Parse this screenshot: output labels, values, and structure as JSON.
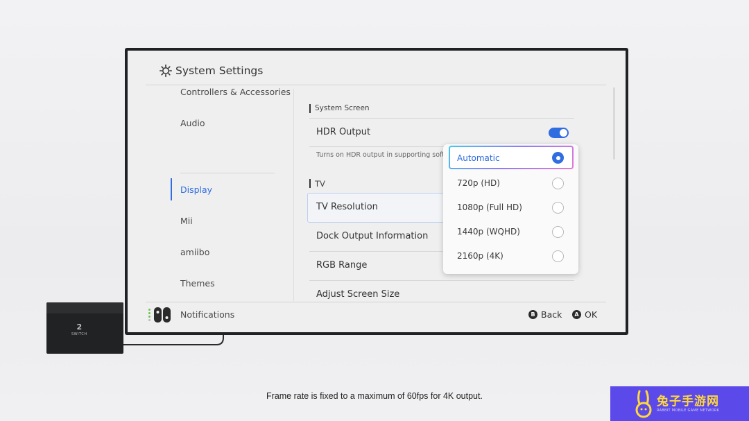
{
  "window": {
    "title": "System Settings",
    "icon": "gear-icon"
  },
  "sidebar": {
    "items": [
      {
        "label": "Controllers & Accessories",
        "active": false
      },
      {
        "label": "Audio",
        "active": false
      },
      {
        "label": "Display",
        "active": true
      },
      {
        "label": "Mii",
        "active": false
      },
      {
        "label": "amiibo",
        "active": false
      },
      {
        "label": "Themes",
        "active": false
      },
      {
        "label": "Notifications",
        "active": false
      }
    ]
  },
  "main": {
    "system_screen": {
      "heading": "System Screen",
      "hdr_output": {
        "label": "HDR Output",
        "enabled": true
      },
      "description": "Turns on HDR output in supporting softw"
    },
    "tv": {
      "heading": "TV",
      "tv_resolution": "TV Resolution",
      "dock_output": "Dock Output Information",
      "rgb_range": "RGB Range",
      "adjust_screen": "Adjust Screen Size"
    }
  },
  "dropdown": {
    "selected": "Automatic",
    "options": [
      "Automatic",
      "720p (HD)",
      "1080p (Full HD)",
      "1440p (WQHD)",
      "2160p (4K)"
    ]
  },
  "footer": {
    "back": {
      "button": "B",
      "label": "Back"
    },
    "ok": {
      "button": "A",
      "label": "OK"
    }
  },
  "dock": {
    "logo": "2",
    "brand": "SWITCH"
  },
  "caption": "Frame rate is fixed to a maximum of 60fps for 4K output.",
  "watermark": {
    "cn": "兔子手游网",
    "en": "RABBIT MOBILE GAME NETWORK"
  },
  "colors": {
    "accent": "#2f6de0",
    "watermark_bg": "#5b49ea",
    "watermark_text": "#ffd83a"
  }
}
